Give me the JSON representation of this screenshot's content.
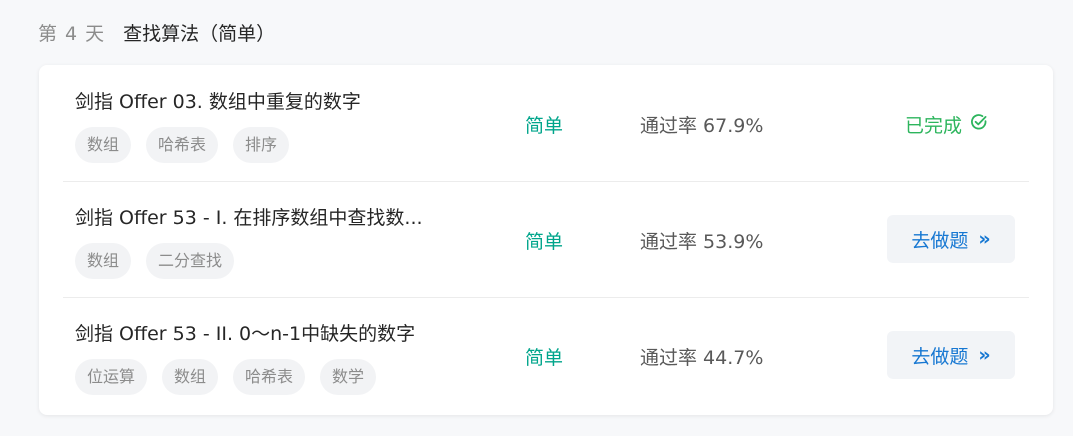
{
  "section": {
    "day": "第 4 天",
    "title": "查找算法（简单）"
  },
  "problems": [
    {
      "title": "剑指 Offer 03. 数组中重复的数字",
      "tags": [
        "数组",
        "哈希表",
        "排序"
      ],
      "difficulty": "简单",
      "pass_rate": "通过率 67.9%",
      "status": "已完成"
    },
    {
      "title": "剑指 Offer 53 - I. 在排序数组中查找数...",
      "tags": [
        "数组",
        "二分查找"
      ],
      "difficulty": "简单",
      "pass_rate": "通过率 53.9%",
      "action": "去做题"
    },
    {
      "title": "剑指 Offer 53 - II. 0～n-1中缺失的数字",
      "tags": [
        "位运算",
        "数组",
        "哈希表",
        "数学"
      ],
      "difficulty": "简单",
      "pass_rate": "通过率 44.7%",
      "action": "去做题"
    }
  ],
  "colors": {
    "easy": "#00a58b",
    "done": "#2db55d",
    "link": "#1677d2"
  },
  "icons": {
    "done": "check-circle-icon",
    "go": "double-chevron-right-icon"
  }
}
